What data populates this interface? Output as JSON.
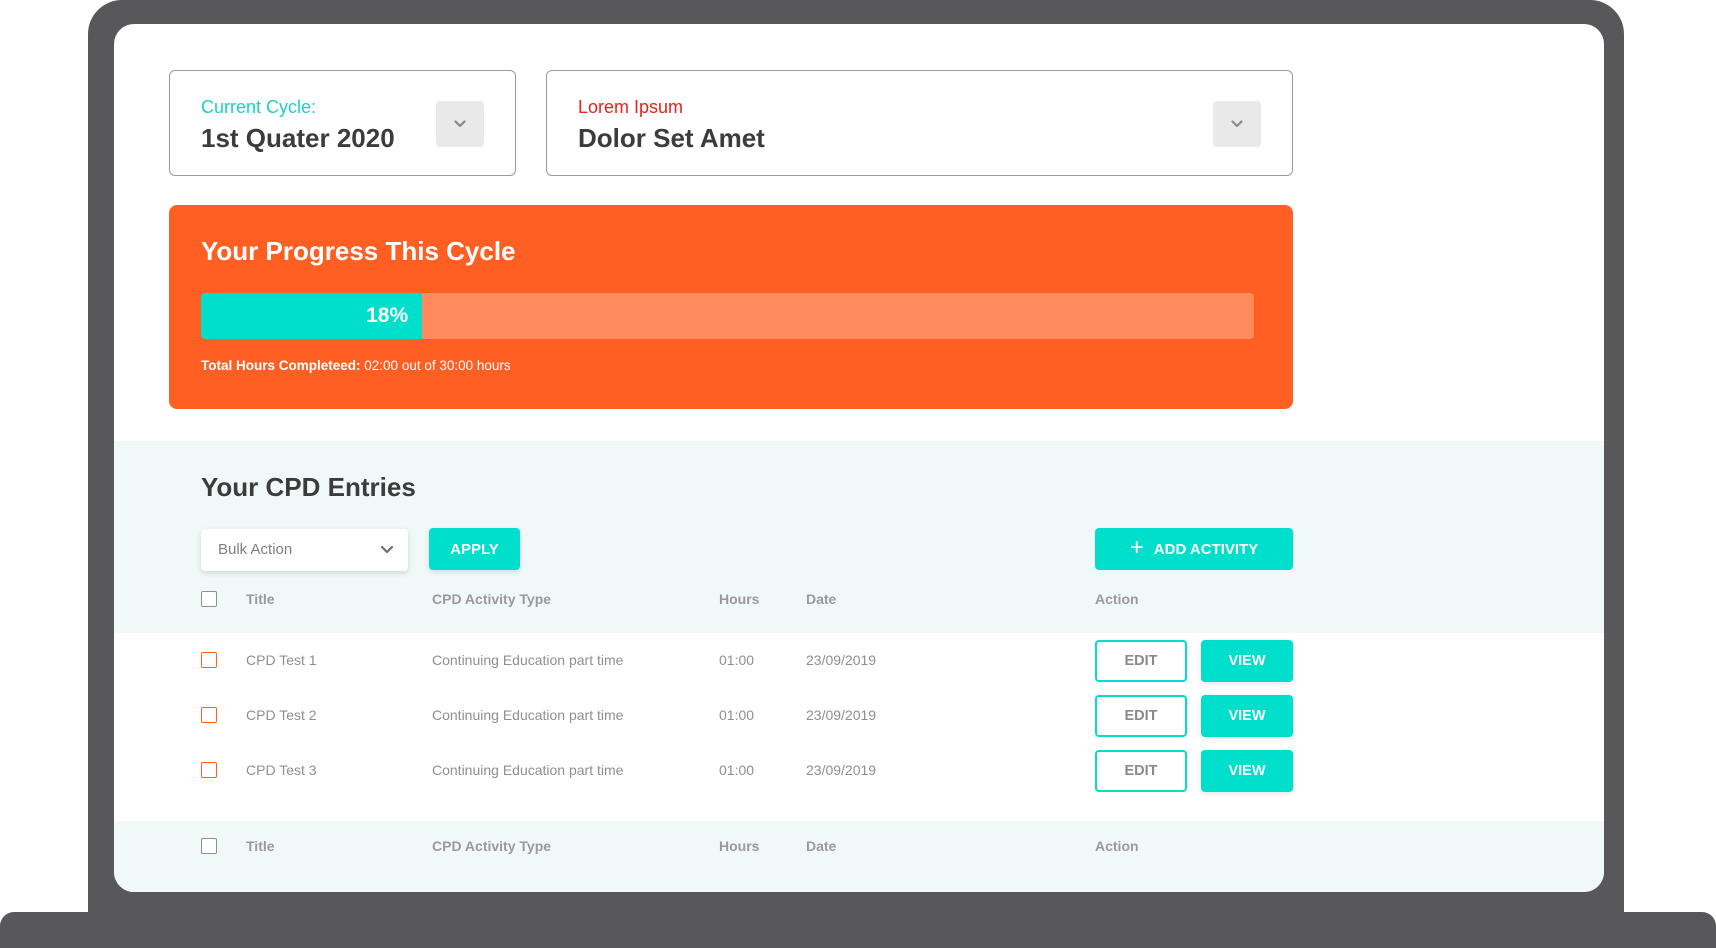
{
  "cycle_selector": {
    "label": "Current Cycle:",
    "value": "1st Quater 2020"
  },
  "secondary_selector": {
    "label": "Lorem Ipsum",
    "value": "Dolor Set Amet"
  },
  "progress": {
    "title": "Your Progress This Cycle",
    "percent": 18,
    "percent_label": "18%",
    "hours_label": "Total Hours Completeed:",
    "hours_value": "02:00 out of 30:00 hours"
  },
  "entries": {
    "title": "Your CPD Entries",
    "bulk_action": {
      "selected": "Bulk Action"
    },
    "apply_label": "APPLY",
    "add_label": "ADD ACTIVITY",
    "columns": {
      "title": "Title",
      "type": "CPD Activity Type",
      "hours": "Hours",
      "date": "Date",
      "action": "Action"
    },
    "rows": [
      {
        "title": "CPD Test 1",
        "type": "Continuing Education part time",
        "hours": "01:00",
        "date": "23/09/2019",
        "edit": "EDIT",
        "view": "VIEW"
      },
      {
        "title": "CPD Test 2",
        "type": "Continuing Education part time",
        "hours": "01:00",
        "date": "23/09/2019",
        "edit": "EDIT",
        "view": "VIEW"
      },
      {
        "title": "CPD Test 3",
        "type": "Continuing Education part time",
        "hours": "01:00",
        "date": "23/09/2019",
        "edit": "EDIT",
        "view": "VIEW"
      }
    ]
  },
  "icons": {
    "dropdown": "chevron-down-icon",
    "add": "plus-icon"
  },
  "colors": {
    "accent": "#00dfcb",
    "progress_card": "#ff5f22",
    "progress_track": "#ff8a5c",
    "label_teal": "#1ecfc4",
    "label_red": "#e3241b",
    "frame": "#58585a",
    "entries_bg": "#f1f8f8"
  }
}
